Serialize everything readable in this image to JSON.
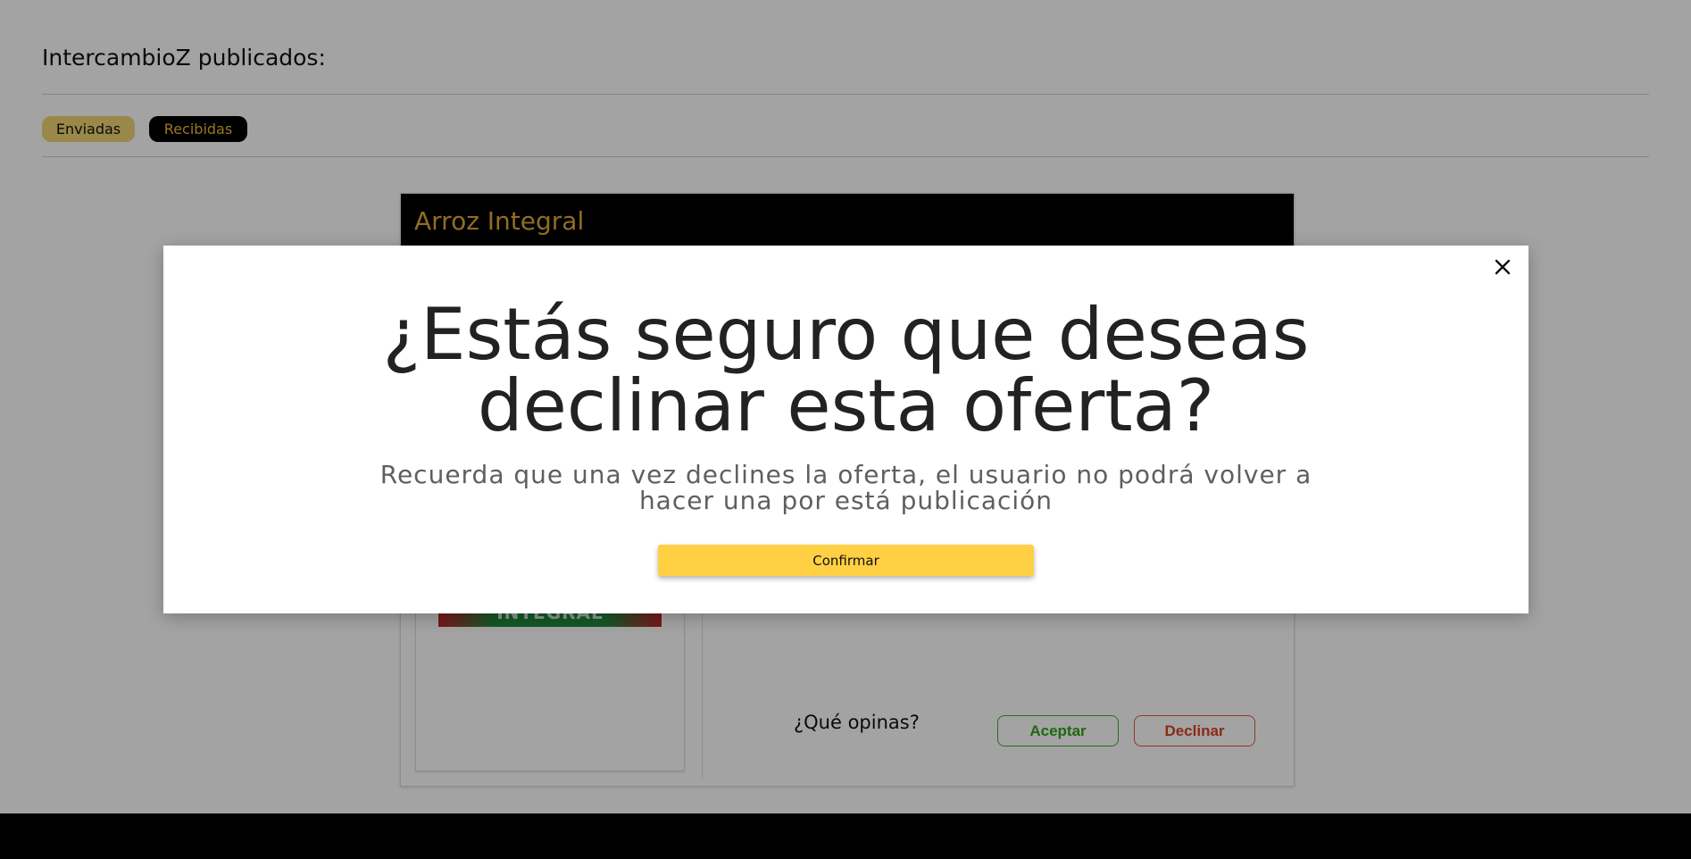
{
  "header": {
    "title": "IntercambioZ publicados:"
  },
  "tabs": [
    {
      "label": "Enviadas",
      "active": false
    },
    {
      "label": "Recibidas",
      "active": true
    }
  ],
  "card": {
    "title": "Arroz Integral",
    "product_image_text": "INTEGRAL",
    "question": "¿Qué opinas?",
    "accept_label": "Aceptar",
    "decline_label": "Declinar"
  },
  "modal": {
    "title": "¿Estás seguro que deseas declinar esta oferta?",
    "subtitle": "Recuerda que una vez declines la oferta, el usuario no podrá volver a hacer una por está publicación",
    "confirm_label": "Confirmar",
    "close_icon": "close-icon"
  },
  "colors": {
    "accent_yellow": "#ffd043",
    "gold": "#e3a936",
    "accept_green": "#2ea31a",
    "decline_red": "#d8421f"
  }
}
